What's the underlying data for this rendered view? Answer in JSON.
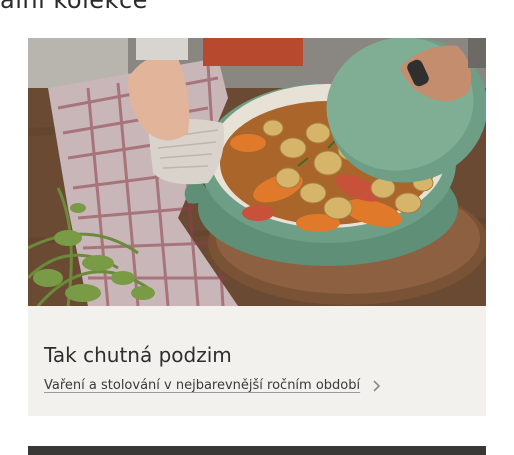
{
  "section": {
    "title": "ální kolekce"
  },
  "card": {
    "title": "Tak chutná podzim",
    "link_text": "Vaření a stolování v nejbarevnější ročním období",
    "link_icon": "chevron-right-icon",
    "image_subject": "green enamel cast-iron pot with roasted vegetables",
    "colors": {
      "card_bg": "#f3f1ee",
      "pot_green": "#6e9e86",
      "lid_green": "#7fae94",
      "table_wood": "#6b4a33"
    }
  }
}
